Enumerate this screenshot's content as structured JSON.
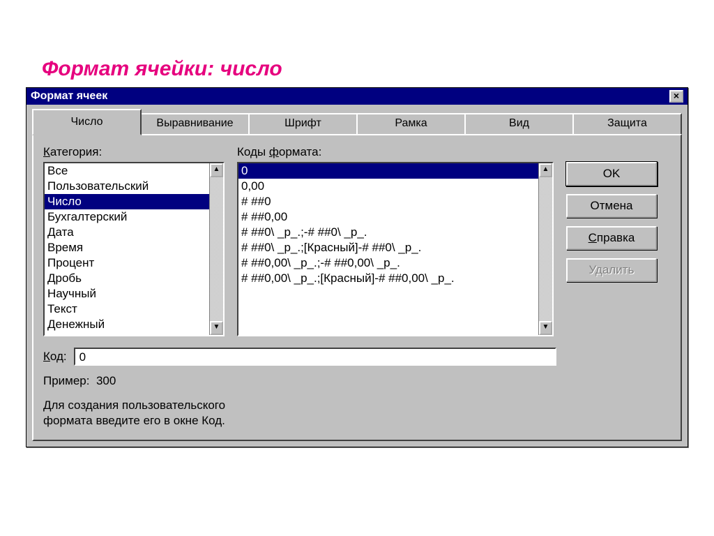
{
  "slide_title": "Формат ячейки:  число",
  "window": {
    "title": "Формат ячеек",
    "close_glyph": "×"
  },
  "tabs": {
    "items": [
      {
        "label": "Число",
        "active": true
      },
      {
        "label": "Выравнивание",
        "active": false
      },
      {
        "label": "Шрифт",
        "active": false
      },
      {
        "label": "Рамка",
        "active": false
      },
      {
        "label": "Вид",
        "active": false
      },
      {
        "label": "Защита",
        "active": false
      }
    ]
  },
  "category": {
    "label_u": "К",
    "label_rest": "атегория:",
    "items": [
      {
        "label": "Все",
        "selected": false
      },
      {
        "label": "Пользовательский",
        "selected": false
      },
      {
        "label": "Число",
        "selected": true
      },
      {
        "label": "Бухгалтерский",
        "selected": false
      },
      {
        "label": "Дата",
        "selected": false
      },
      {
        "label": "Время",
        "selected": false
      },
      {
        "label": "Процент",
        "selected": false
      },
      {
        "label": "Дробь",
        "selected": false
      },
      {
        "label": "Научный",
        "selected": false
      },
      {
        "label": "Текст",
        "selected": false
      },
      {
        "label": "Денежный",
        "selected": false
      }
    ]
  },
  "codes": {
    "label_plain1": "Коды ",
    "label_u": "ф",
    "label_plain2": "ормата:",
    "items": [
      {
        "label": "0",
        "selected": true
      },
      {
        "label": "0,00",
        "selected": false
      },
      {
        "label": "# ##0",
        "selected": false
      },
      {
        "label": "# ##0,00",
        "selected": false
      },
      {
        "label": "# ##0\\ _р_.;-# ##0\\ _р_.",
        "selected": false
      },
      {
        "label": "# ##0\\ _р_.;[Красный]-# ##0\\ _р_.",
        "selected": false
      },
      {
        "label": "# ##0,00\\ _р_.;-# ##0,00\\ _р_.",
        "selected": false
      },
      {
        "label": "# ##0,00\\ _р_.;[Красный]-# ##0,00\\ _р_.",
        "selected": false
      }
    ]
  },
  "buttons": {
    "ok": "OK",
    "cancel": "Отмена",
    "help_u": "С",
    "help_rest": "правка",
    "delete": "Удалить"
  },
  "code_input": {
    "label_u": "К",
    "label_rest": "од:",
    "value": "0"
  },
  "example": {
    "label": "Пример:",
    "value": "300"
  },
  "hint": {
    "line1": "Для создания пользовательского",
    "line2": "формата введите его в окне Код."
  },
  "scroll": {
    "up": "▲",
    "down": "▼"
  }
}
